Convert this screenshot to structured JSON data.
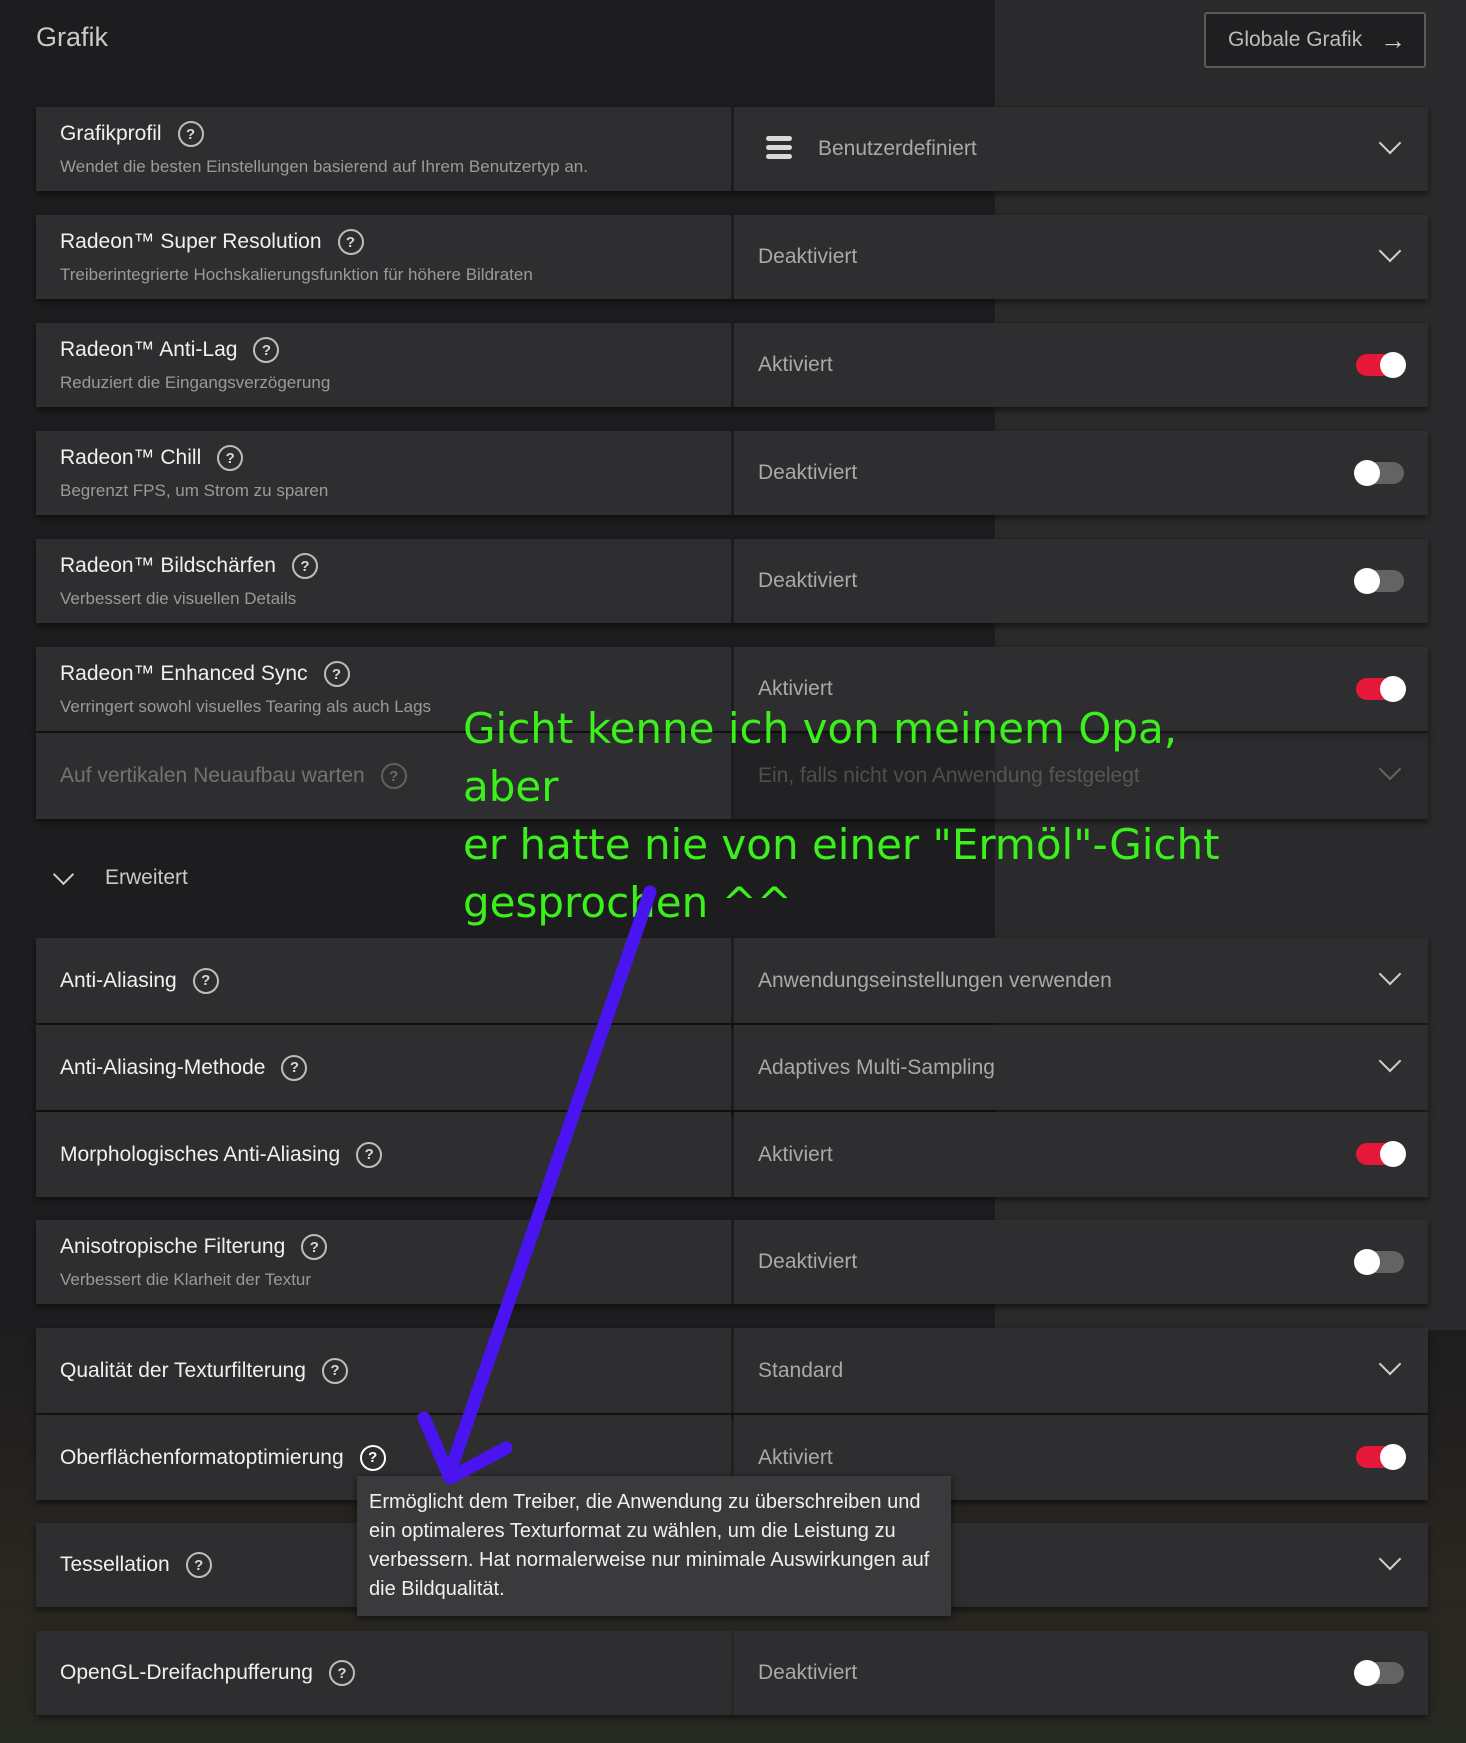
{
  "header": {
    "title": "Grafik",
    "global_button": "Globale Grafik"
  },
  "rows": [
    {
      "label": "Grafikprofil",
      "desc": "Wendet die besten Einstellungen basierend auf Ihrem Benutzertyp an.",
      "value": "Benutzerdefiniert",
      "control": "dropdown"
    },
    {
      "label": "Radeon™ Super Resolution",
      "desc": "Treiberintegrierte Hochskalierungsfunktion für höhere Bildraten",
      "value": "Deaktiviert",
      "control": "dropdown"
    },
    {
      "label": "Radeon™ Anti-Lag",
      "desc": "Reduziert die Eingangsverzögerung",
      "value": "Aktiviert",
      "control": "toggle-on"
    },
    {
      "label": "Radeon™ Chill",
      "desc": "Begrenzt FPS, um Strom zu sparen",
      "value": "Deaktiviert",
      "control": "toggle-off"
    },
    {
      "label": "Radeon™ Bildschärfen",
      "desc": "Verbessert die visuellen Details",
      "value": "Deaktiviert",
      "control": "toggle-off"
    },
    {
      "label": "Radeon™ Enhanced Sync",
      "desc": "Verringert sowohl visuelles Tearing als auch Lags",
      "value": "Aktiviert",
      "control": "toggle-on"
    }
  ],
  "subrow": {
    "label": "Auf vertikalen Neuaufbau warten",
    "value": "Ein, falls nicht von Anwendung festgelegt"
  },
  "section": {
    "label": "Erweitert"
  },
  "advanced": [
    {
      "label": "Anti-Aliasing",
      "value": "Anwendungseinstellungen verwenden",
      "control": "dropdown"
    },
    {
      "label": "Anti-Aliasing-Methode",
      "value": "Adaptives Multi-Sampling",
      "control": "dropdown"
    },
    {
      "label": "Morphologisches Anti-Aliasing",
      "value": "Aktiviert",
      "control": "toggle-on"
    },
    {
      "label": "Anisotropische Filterung",
      "desc": "Verbessert die Klarheit der Textur",
      "value": "Deaktiviert",
      "control": "toggle-off"
    },
    {
      "label": "Qualität der Texturfilterung",
      "value": "Standard",
      "control": "dropdown"
    },
    {
      "label": "Oberflächenformatoptimierung",
      "value": "Aktiviert",
      "control": "toggle-on"
    },
    {
      "label": "Tessellation",
      "value": "",
      "control": "dropdown"
    },
    {
      "label": "OpenGL-Dreifachpufferung",
      "value": "Deaktiviert",
      "control": "toggle-off"
    }
  ],
  "tooltip": "Ermöglicht dem Treiber, die Anwendung zu überschreiben und ein optimaleres Texturformat zu wählen, um die Leistung zu verbessern. Hat normalerweise nur minimale Auswirkungen auf die Bildqualität.",
  "annotation": {
    "line1": "Gicht kenne ich von meinem Opa, aber",
    "line2": "er hatte nie von einer \"Ermöl\"-Gicht",
    "line3": "gesprochen ^^",
    "color": "#3cf01c",
    "arrow_color": "#4a14f0"
  },
  "colors": {
    "toggle_on": "#e5183a",
    "toggle_off": "#636363",
    "row_bg": "#2e2e30"
  }
}
